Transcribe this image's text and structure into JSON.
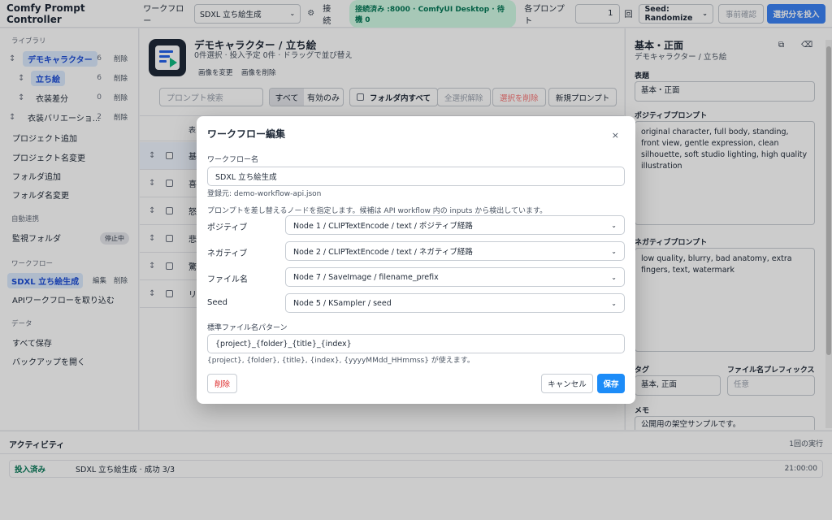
{
  "topbar": {
    "app_title": "Comfy Prompt Controller",
    "workflow_label": "ワークフロー",
    "workflow_value": "SDXL 立ち絵生成",
    "connection_label": "接続",
    "connection_status": "接続済み :8000 · ComfyUI Desktop · 待機 0",
    "per_prompt_label": "各プロンプト",
    "per_prompt_count": "1",
    "per_prompt_unit": "回",
    "seed_value": "Seed: Randomize",
    "pre_check_label": "事前確認",
    "submit_label": "選択分を投入"
  },
  "sidebar": {
    "library_heading": "ライブラリ",
    "tree": [
      {
        "label": "デモキャラクター",
        "count": "6",
        "delete": "削除"
      },
      {
        "label": "立ち絵",
        "count": "6",
        "delete": "削除"
      },
      {
        "label": "衣装差分",
        "count": "0",
        "delete": "削除"
      },
      {
        "label": "衣装バリエーショ...",
        "count": "2",
        "delete": "削除"
      }
    ],
    "actions": [
      "プロジェクト追加",
      "プロジェクト名変更",
      "フォルダ追加",
      "フォルダ名変更"
    ],
    "auto_heading": "自動連携",
    "watch_folder_label": "監視フォルダ",
    "watch_status": "停止中",
    "workflow_heading": "ワークフロー",
    "workflow_item": "SDXL 立ち絵生成",
    "workflow_edit": "編集",
    "workflow_delete": "削除",
    "import_api": "APIワークフローを取り込む",
    "data_heading": "データ",
    "save_all": "すべて保存",
    "open_backup": "バックアップを開く"
  },
  "main": {
    "title": "デモキャラクター / 立ち絵",
    "subtitle": "0件選択 · 投入予定 0件 · ドラッグで並び替え",
    "change_image": "画像を変更",
    "delete_image": "画像を削除",
    "search_placeholder": "プロンプト検索",
    "filter_all": "すべて",
    "filter_enabled": "有効のみ",
    "all_in_folder": "フォルダ内すべて",
    "clear_selection": "全選択解除",
    "delete_selection": "選択を削除",
    "new_prompt": "新規プロンプト",
    "col_header": "表",
    "rows": [
      "基",
      "喜",
      "怒",
      "悲",
      "驚",
      "リ"
    ]
  },
  "right_panel": {
    "title": "基本・正面",
    "subtitle": "デモキャラクター / 立ち絵",
    "title_label": "表題",
    "title_value": "基本・正面",
    "positive_label": "ポジティブプロンプト",
    "positive_value": "original character, full body, standing, front view, gentle expression, clean silhouette, soft studio lighting, high quality illustration",
    "negative_label": "ネガティブプロンプト",
    "negative_value": "low quality, blurry, bad anatomy, extra fingers, text, watermark",
    "tag_label": "タグ",
    "tag_value": "基本, 正面",
    "prefix_label": "ファイル名プレフィックス",
    "prefix_placeholder": "任意",
    "memo_label": "メモ",
    "memo_value": "公開用の架空サンプルです。"
  },
  "activity": {
    "heading": "アクティビティ",
    "run_count": "1回の実行",
    "entries": [
      {
        "status": "投入済み",
        "detail": "SDXL 立ち絵生成 · 成功 3/3",
        "time": "21:00:00"
      }
    ]
  },
  "modal": {
    "title": "ワークフロー編集",
    "close": "×",
    "name_label": "ワークフロー名",
    "name_value": "SDXL 立ち絵生成",
    "source": "登録元: demo-workflow-api.json",
    "node_help": "プロンプトを差し替えるノードを指定します。候補は API workflow 内の inputs から検出しています。",
    "mappings": [
      {
        "label": "ポジティブ",
        "value": "Node 1 / CLIPTextEncode / text / ポジティブ経路"
      },
      {
        "label": "ネガティブ",
        "value": "Node 2 / CLIPTextEncode / text / ネガティブ経路"
      },
      {
        "label": "ファイル名",
        "value": "Node 7 / SaveImage / filename_prefix"
      },
      {
        "label": "Seed",
        "value": "Node 5 / KSampler / seed"
      }
    ],
    "pattern_label": "標準ファイル名パターン",
    "pattern_value": "{project}_{folder}_{title}_{index}",
    "pattern_help": "{project}, {folder}, {title}, {index}, {yyyyMMdd_HHmmss} が使えます。",
    "delete_label": "削除",
    "cancel_label": "キャンセル",
    "save_label": "保存"
  },
  "colors": {
    "accent": "#3b82f6",
    "connected_bg": "#d1fae5",
    "connected_text": "#047857",
    "danger": "#dc2626",
    "selected_bg": "#dbeafe"
  }
}
